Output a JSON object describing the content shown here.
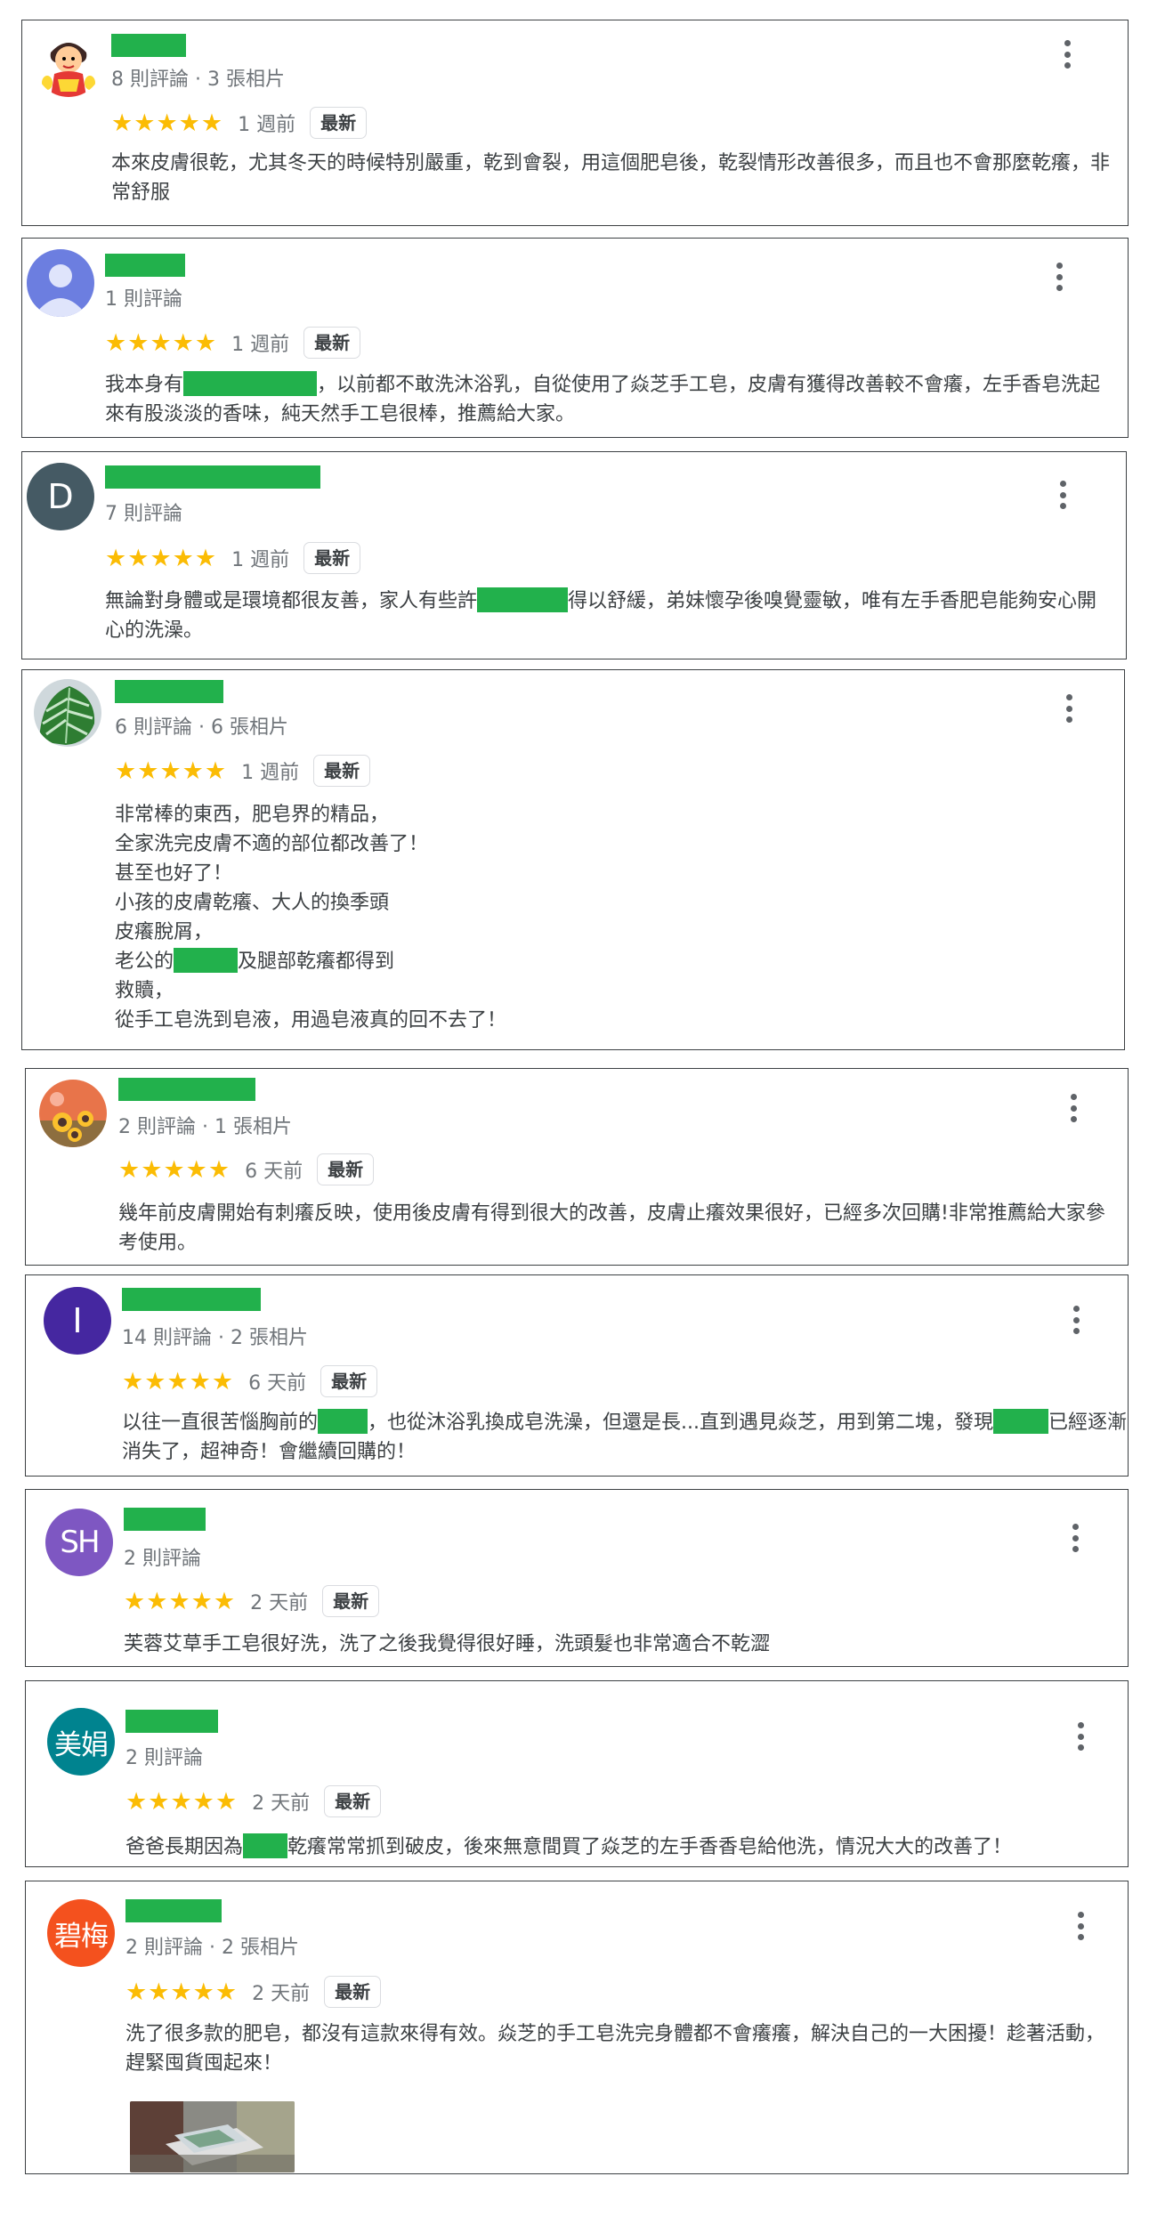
{
  "colors": {
    "star": "#fbbc04",
    "redaction": "#22b14c",
    "border": "#3c4043",
    "meta": "#70757a"
  },
  "icons": {
    "star": "star-icon",
    "more": "more-vert-icon"
  },
  "reviews": [
    {
      "avatar": {
        "type": "image",
        "name": "cartoon-avatar"
      },
      "meta": "8 則評論 · 3 張相片",
      "rating": 5,
      "time": "1 週前",
      "badge": "最新",
      "text": [
        {
          "t": "本來皮膚很乾，尤其冬天的時候特別嚴重，乾到會裂，用這個肥皂後，乾裂情形改善很多，而且也不會那麼乾癢，非常舒服"
        }
      ]
    },
    {
      "avatar": {
        "type": "image",
        "name": "default-avatar"
      },
      "meta": "1 則評論",
      "rating": 5,
      "time": "1 週前",
      "badge": "最新",
      "text": [
        {
          "t": "我本身有"
        },
        {
          "r": 150
        },
        {
          "t": "，以前都不敢洗沐浴乳，自從使用了焱芝手工皂，皮膚有獲得改善較不會癢，左手香皂洗起來有股淡淡的香味，純天然手工皂很棒，推薦給大家。"
        }
      ]
    },
    {
      "avatar": {
        "type": "letter",
        "label": "D",
        "color": "#455a64"
      },
      "meta": "7 則評論",
      "rating": 5,
      "time": "1 週前",
      "badge": "最新",
      "text": [
        {
          "t": "無論對身體或是環境都很友善，家人有些許"
        },
        {
          "r": 102
        },
        {
          "t": "得以舒緩，弟妹懷孕後嗅覺靈敏，唯有左手香肥皂能夠安心開心的洗澡。"
        }
      ]
    },
    {
      "avatar": {
        "type": "image",
        "name": "monstera-leaf-avatar"
      },
      "meta": "6 則評論 · 6 張相片",
      "rating": 5,
      "time": "1 週前",
      "badge": "最新",
      "text": [
        {
          "t": "非常棒的東西，肥皂界的精品，\n全家洗完皮膚不適的部位都改善了！\n甚至也好了！\n小孩的皮膚乾癢、大人的換季頭\n皮癢脫屑，\n老公的"
        },
        {
          "r": 72
        },
        {
          "t": "及腿部乾癢都得到\n救贖，\n從手工皂洗到皂液，用過皂液真的回不去了！"
        }
      ]
    },
    {
      "avatar": {
        "type": "image",
        "name": "sunflower-avatar"
      },
      "meta": "2 則評論 · 1 張相片",
      "rating": 5,
      "time": "6 天前",
      "badge": "最新",
      "text": [
        {
          "t": "幾年前皮膚開始有刺癢反映，使用後皮膚有得到很大的改善，皮膚止癢效果很好，已經多次回購!非常推薦給大家參考使用。"
        }
      ]
    },
    {
      "avatar": {
        "type": "letter",
        "label": "I",
        "color": "#4527a0"
      },
      "meta": "14 則評論 · 2 張相片",
      "rating": 5,
      "time": "6 天前",
      "badge": "最新",
      "text": [
        {
          "t": "以往一直很苦惱胸前的"
        },
        {
          "r": 56
        },
        {
          "t": "，也從沐浴乳換成皂洗澡，但還是長...直到遇見焱芝，用到第二塊，發現"
        },
        {
          "r": 62
        },
        {
          "t": "已經逐漸消失了，超神奇！會繼續回購的！"
        }
      ]
    },
    {
      "avatar": {
        "type": "letter",
        "label": "SH",
        "color": "#7e57c2"
      },
      "meta": "2 則評論",
      "rating": 5,
      "time": "2 天前",
      "badge": "最新",
      "text": [
        {
          "t": "芙蓉艾草手工皂很好洗，洗了之後我覺得很好睡，洗頭髮也非常適合不乾澀"
        }
      ]
    },
    {
      "avatar": {
        "type": "letter",
        "label": "美娟",
        "color": "#00838f"
      },
      "meta": "2 則評論",
      "rating": 5,
      "time": "2 天前",
      "badge": "最新",
      "text": [
        {
          "t": "爸爸長期因為"
        },
        {
          "r": 50
        },
        {
          "t": "乾癢常常抓到破皮，後來無意間買了焱芝的左手香香皂給他洗，情況大大的改善了！"
        }
      ]
    },
    {
      "avatar": {
        "type": "letter",
        "label": "碧梅",
        "color": "#f4511e"
      },
      "meta": "2 則評論 · 2 張相片",
      "rating": 5,
      "time": "2 天前",
      "badge": "最新",
      "text": [
        {
          "t": "洗了很多款的肥皂，都沒有這款來得有效。焱芝的手工皂洗完身體都不會癢癢，解決自己的一大困擾！趁著活動，趕緊囤貨囤起來！"
        }
      ],
      "photo": "soap-photo"
    }
  ]
}
